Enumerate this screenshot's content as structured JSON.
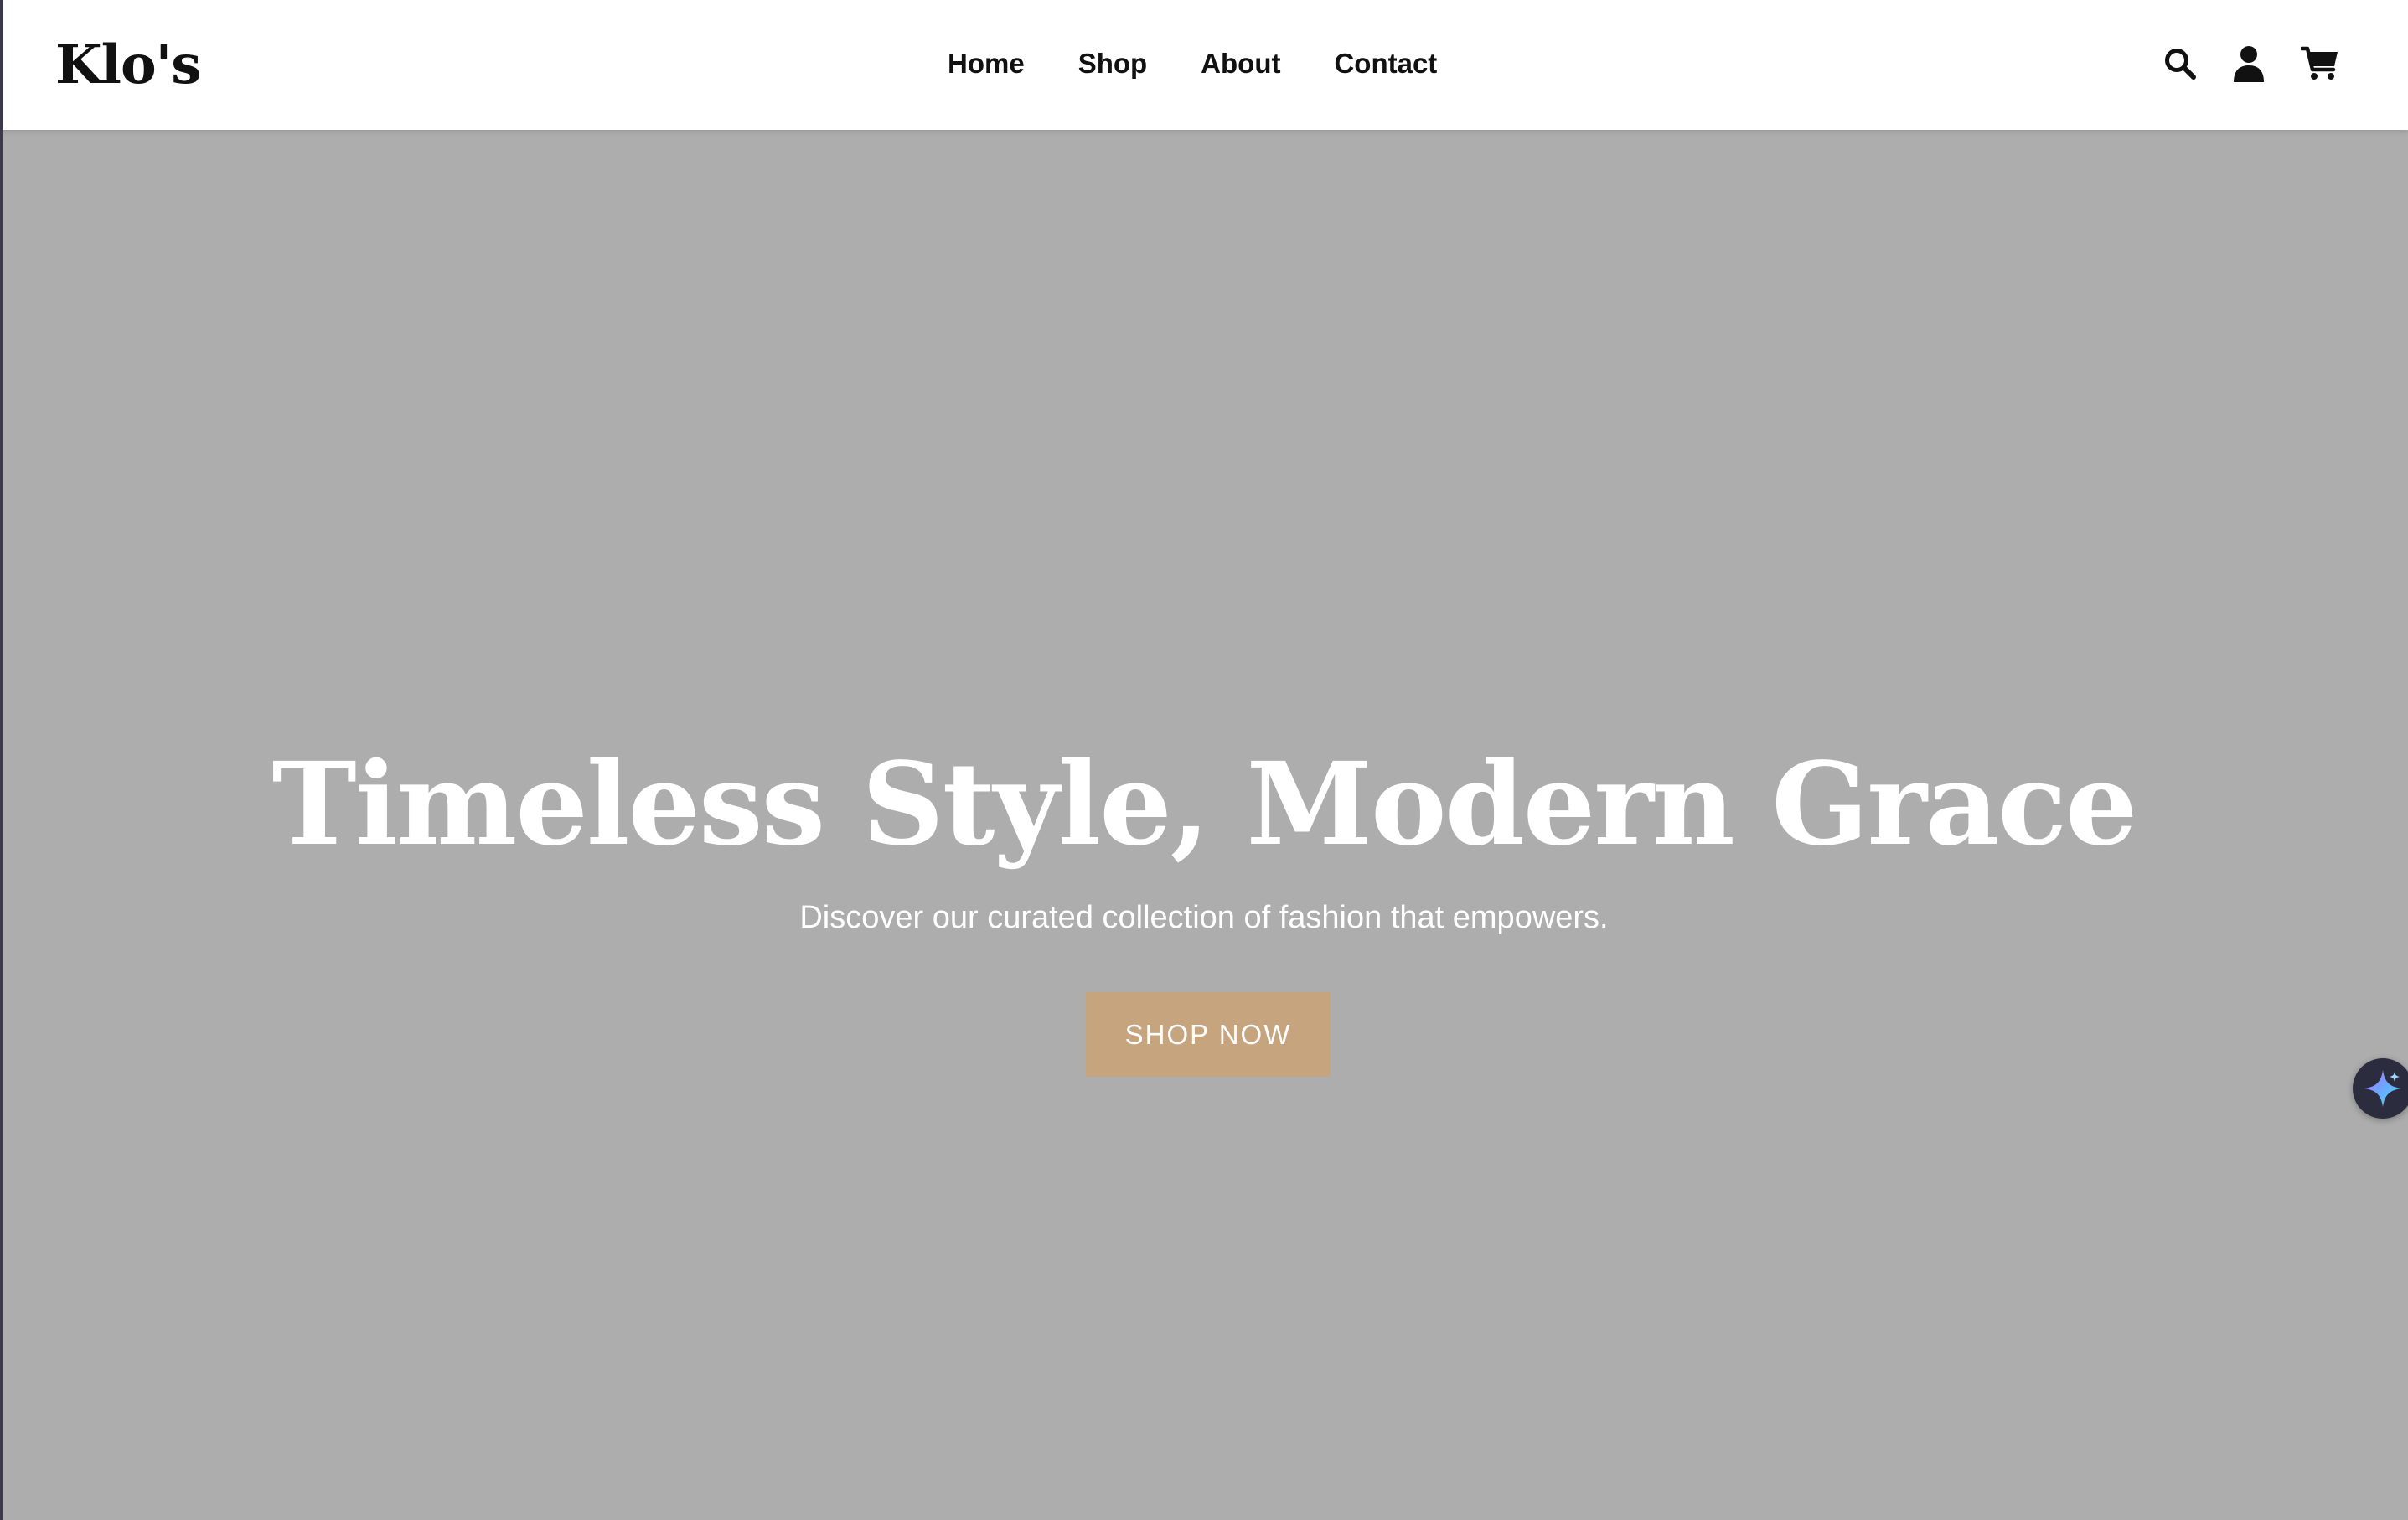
{
  "brand": {
    "logo_text": "Klo's"
  },
  "nav": {
    "links": [
      {
        "label": "Home"
      },
      {
        "label": "Shop"
      },
      {
        "label": "About"
      },
      {
        "label": "Contact"
      }
    ],
    "icons": [
      "search-icon",
      "user-icon",
      "cart-icon"
    ]
  },
  "hero": {
    "title": "Timeless Style, Modern Grace",
    "subtitle": "Discover our curated collection of fashion that empowers.",
    "cta_label": "SHOP NOW"
  },
  "assistant": {
    "icon": "sparkle-icon"
  },
  "colors": {
    "accent": "#c6a47e",
    "hero_background": "#adadad",
    "navbar_background": "#ffffff",
    "text_dark": "#111111",
    "assistant_background": "#2b2d3e"
  }
}
